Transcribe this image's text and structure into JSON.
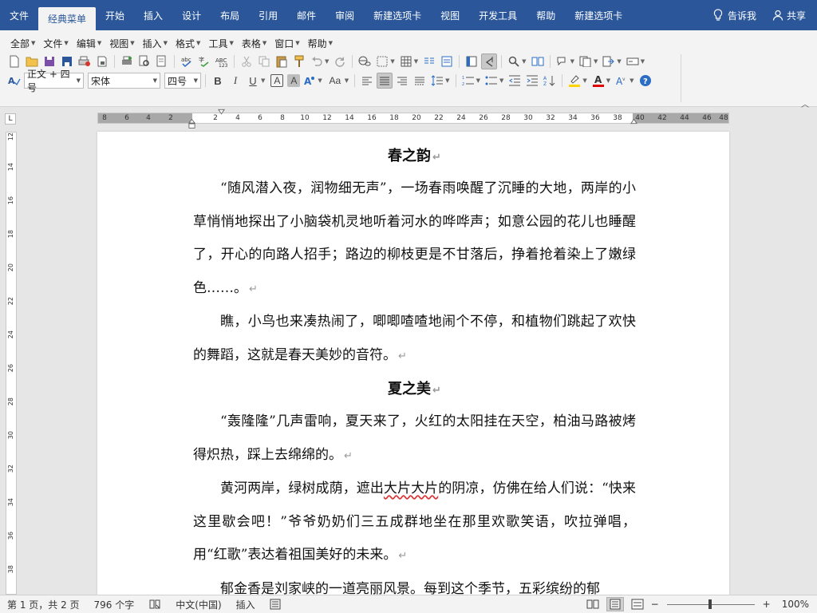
{
  "tabs": [
    "文件",
    "经典菜单",
    "开始",
    "插入",
    "设计",
    "布局",
    "引用",
    "邮件",
    "审阅",
    "新建选项卡",
    "视图",
    "开发工具",
    "帮助",
    "新建选项卡"
  ],
  "active_tab_index": 1,
  "tell_me": "告诉我",
  "share": "共享",
  "menu": [
    "全部",
    "文件",
    "编辑",
    "视图",
    "插入",
    "格式",
    "工具",
    "表格",
    "窗口",
    "帮助"
  ],
  "format": {
    "style": "正文 + 四号",
    "font": "宋体",
    "size": "四号",
    "bold": "B",
    "italic": "I",
    "underline": "U",
    "char_border": "A",
    "char_shade": "A",
    "case": "Aa"
  },
  "ruler": {
    "h_left": [
      "8",
      "6",
      "4",
      "2"
    ],
    "h_right": [
      "2",
      "4",
      "6",
      "8",
      "10",
      "12",
      "14",
      "16",
      "18",
      "20",
      "22",
      "24",
      "26",
      "28",
      "30",
      "32",
      "34",
      "36",
      "38",
      "40",
      "42",
      "44",
      "46",
      "48"
    ],
    "v": [
      "12",
      "14",
      "16",
      "18",
      "20",
      "22",
      "24",
      "26",
      "28",
      "30",
      "32",
      "34",
      "36",
      "38"
    ]
  },
  "document": {
    "title1": "春之韵",
    "p1": "“随风潜入夜，润物细无声”，一场春雨唤醒了沉睡的大地，两岸的小草悄悄地探出了小脑袋机灵地听着河水的哗哗声；如意公园的花儿也睡醒了，开心的向路人招手；路边的柳枝更是不甘落后，挣着抢着染上了嫩绿色……。",
    "p2": "瞧，小鸟也来凑热闹了，唧唧喳喳地闹个不停，和植物们跳起了欢快的舞蹈，这就是春天美妙的音符。",
    "title2": "夏之美",
    "p3": "“轰隆隆”几声雷响，夏天来了，火红的太阳挂在天空，柏油马路被烤得炽热，踩上去绵绵的。",
    "p4a": "黄河两岸，绿树成荫，遮出",
    "p4b": "大片大片",
    "p4c": "的阴凉，仿佛在给人们说：“快来这里歇会吧！”爷爷奶奶们三五成群地坐在那里欢歌笑语，吹拉弹唱，用“红歌”表达着祖国美好的未来。",
    "p5": "郁金香是刘家峡的一道亮丽风景。每到这个季节，五彩缤纷的郁",
    "para_mark": "↵"
  },
  "status": {
    "page": "第 1 页，共 2 页",
    "words": "796 个字",
    "lang": "中文(中国)",
    "mode": "插入",
    "zoom": "100%",
    "zoom_minus": "−",
    "zoom_plus": "+"
  },
  "colors": {
    "ribbon_blue": "#2b579a",
    "highlight_yellow": "#ffd400",
    "font_red": "#e00000",
    "help_blue": "#2b6cc4"
  }
}
